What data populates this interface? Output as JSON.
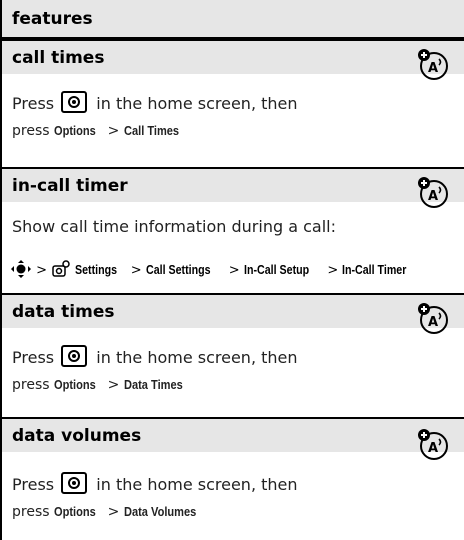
{
  "header": {
    "title": "features"
  },
  "sections": [
    {
      "title": "call times",
      "line1_pre": "Press",
      "line1_post": "in the home screen, then",
      "line2_pre": "press",
      "menu1": "Options",
      "sep": ">",
      "menu2": "Call Times"
    },
    {
      "title": "in-call timer",
      "desc": "Show call time information during a call:",
      "path": [
        "Settings",
        "Call Settings",
        "In-Call Setup",
        "In-Call Timer"
      ],
      "sep": ">"
    },
    {
      "title": "data times",
      "line1_pre": "Press",
      "line1_post": "in the home screen, then",
      "line2_pre": "press",
      "menu1": "Options",
      "sep": ">",
      "menu2": "Data Times"
    },
    {
      "title": "data volumes",
      "line1_pre": "Press",
      "line1_post": "in the home screen, then",
      "line2_pre": "press",
      "menu1": "Options",
      "sep": ">",
      "menu2": "Data Volumes"
    }
  ],
  "icons": {
    "network": "network-dependent-feature-icon",
    "key": "smart-key-icon",
    "nav": "navigation-key-icon",
    "settings": "settings-icon"
  }
}
